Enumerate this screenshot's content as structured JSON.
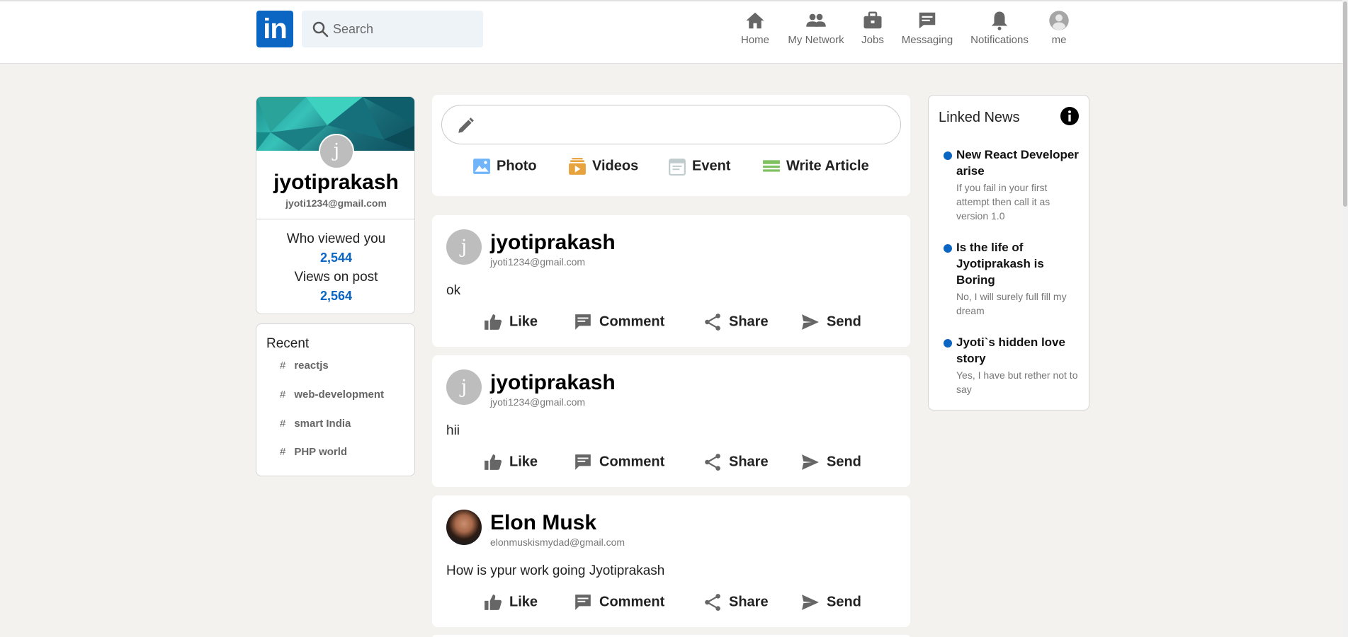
{
  "header": {
    "logo_text": "in",
    "search_placeholder": "Search",
    "nav": [
      {
        "label": "Home",
        "icon": "home-icon"
      },
      {
        "label": "My Network",
        "icon": "network-icon"
      },
      {
        "label": "Jobs",
        "icon": "briefcase-icon"
      },
      {
        "label": "Messaging",
        "icon": "message-icon"
      },
      {
        "label": "Notifications",
        "icon": "bell-icon"
      },
      {
        "label": "me",
        "icon": "avatar-icon"
      }
    ]
  },
  "profile": {
    "avatar_letter": "j",
    "name": "jyotiprakash",
    "email": "jyoti1234@gmail.com",
    "stats": [
      {
        "label": "Who viewed you",
        "value": "2,544"
      },
      {
        "label": "Views on post",
        "value": "2,564"
      }
    ]
  },
  "recent": {
    "title": "Recent",
    "tags": [
      "reactjs",
      "web-development",
      "smart India",
      "PHP world"
    ]
  },
  "share_box": {
    "options": [
      {
        "label": "Photo",
        "icon": "photo-icon",
        "color": "#70b5f9"
      },
      {
        "label": "Videos",
        "icon": "video-icon",
        "color": "#e7a33e"
      },
      {
        "label": "Event",
        "icon": "calendar-icon",
        "color": "#c0cbcd"
      },
      {
        "label": "Write Article",
        "icon": "article-icon",
        "color": "#7fc15e"
      }
    ]
  },
  "posts": [
    {
      "avatar_letter": "j",
      "name": "jyotiprakash",
      "email": "jyoti1234@gmail.com",
      "text": "ok"
    },
    {
      "avatar_letter": "j",
      "name": "jyotiprakash",
      "email": "jyoti1234@gmail.com",
      "text": "hii"
    },
    {
      "avatar_letter": "",
      "name": "Elon Musk",
      "email": "elonmuskismydad@gmail.com",
      "text": "How is ypur work going Jyotiprakash"
    }
  ],
  "post_actions": [
    "Like",
    "Comment",
    "Share",
    "Send"
  ],
  "news": {
    "title": "Linked News",
    "items": [
      {
        "heading": "New React Developer arise",
        "subtitle": "If you fail in your first attempt then call it as version 1.0"
      },
      {
        "heading": "Is the life of Jyotiprakash is Boring",
        "subtitle": "No, I will surely full fill my dream"
      },
      {
        "heading": "Jyoti`s hidden love story",
        "subtitle": "Yes, I have but rether not to say"
      }
    ]
  },
  "colors": {
    "brand": "#0a66c2",
    "background": "#f3f2ef",
    "stat_value": "#0a66c2"
  }
}
